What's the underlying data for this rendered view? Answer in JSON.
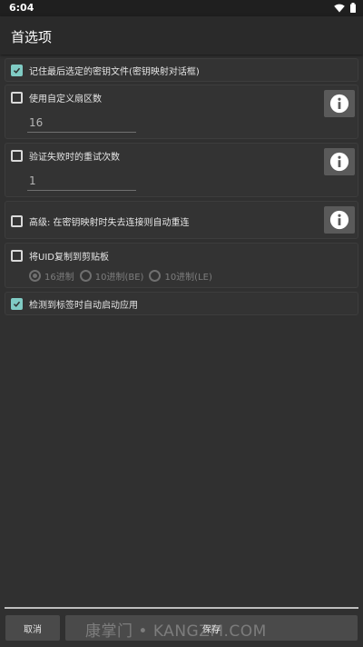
{
  "status_bar": {
    "time": "6:04"
  },
  "app_bar": {
    "title": "首选项"
  },
  "preferences": {
    "remember_last_key": {
      "label": "记住最后选定的密钥文件(密钥映射对话框)",
      "checked": true
    },
    "custom_sectors": {
      "label": "使用自定义扇区数",
      "checked": false,
      "value": "16"
    },
    "retry_count": {
      "label": "验证失败时的重试次数",
      "checked": false,
      "value": "1"
    },
    "auto_reconnect": {
      "label": "高级: 在密钥映射时失去连接则自动重连",
      "checked": false
    },
    "copy_uid": {
      "label": "将UID复制到剪贴板",
      "checked": false,
      "options": [
        "16进制",
        "10进制(BE)",
        "10进制(LE)"
      ],
      "selected": "16进制"
    },
    "auto_start_on_tag": {
      "label": "检测到标签时自动启动应用",
      "checked": true
    }
  },
  "buttons": {
    "cancel": "取消",
    "save": "保存"
  },
  "watermark": "康掌门 • KANGZM.COM",
  "colors": {
    "accent": "#80cbc4",
    "background": "#303030",
    "card": "#333333",
    "button": "#4a4a4a"
  }
}
